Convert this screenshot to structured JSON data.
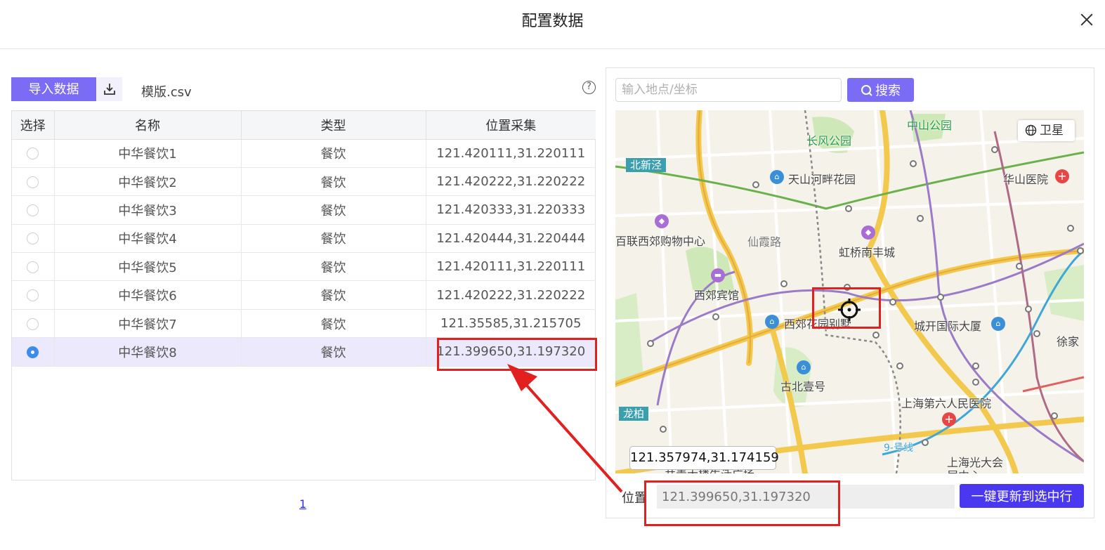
{
  "dialog": {
    "title": "配置数据"
  },
  "toolbar": {
    "import_label": "导入数据",
    "template_name": "模版.csv",
    "help_glyph": "?"
  },
  "table": {
    "headers": [
      "选择",
      "名称",
      "类型",
      "位置采集"
    ],
    "rows": [
      {
        "name": "中华餐饮1",
        "type": "餐饮",
        "position": "121.420111,31.220111",
        "selected": false
      },
      {
        "name": "中华餐饮2",
        "type": "餐饮",
        "position": "121.420222,31.220222",
        "selected": false
      },
      {
        "name": "中华餐饮3",
        "type": "餐饮",
        "position": "121.420333,31.220333",
        "selected": false
      },
      {
        "name": "中华餐饮4",
        "type": "餐饮",
        "position": "121.420444,31.220444",
        "selected": false
      },
      {
        "name": "中华餐饮5",
        "type": "餐饮",
        "position": "121.420111,31.220111",
        "selected": false
      },
      {
        "name": "中华餐饮6",
        "type": "餐饮",
        "position": "121.420222,31.220222",
        "selected": false
      },
      {
        "name": "中华餐饮7",
        "type": "餐饮",
        "position": "121.35585,31.215705",
        "selected": false
      },
      {
        "name": "中华餐饮8",
        "type": "餐饮",
        "position": "121.399650,31.197320",
        "selected": true
      }
    ]
  },
  "pagination": {
    "current": "1"
  },
  "search": {
    "placeholder": "输入地点/坐标",
    "button_label": "搜索"
  },
  "map": {
    "satellite_label": "卫星",
    "center_coord": "121.357974,31.174159",
    "labels": {
      "changfeng_park": "长风公园",
      "zhongshan_park": "中山公园",
      "beixinjing": "北新泾",
      "tianshan_garden": "天山河畔花园",
      "huashan_hospital": "华山医院",
      "bailian_mall": "百联西郊购物中心",
      "xianxia_road": "仙霞路",
      "hongqiao_nanfeng": "虹桥南丰城",
      "xijiao_hotel": "西郊宾馆",
      "xijiao_villa": "西郊花园别墅",
      "chengkai_plaza": "城开国际大厦",
      "xujia": "徐家",
      "gubei": "古北壹号",
      "longbai": "龙柏",
      "sixth_hospital": "上海第六人民医院",
      "line9": "9-号线",
      "guangda": "上海光大会",
      "guangda2": "展中心",
      "bottom_road": "共青大楼生活广场"
    },
    "colors": {
      "road_major": "#f2c94c",
      "metro_purple": "#9b7bc8",
      "metro_green": "#6ab04c",
      "metro_blue": "#3fa7d6",
      "park": "#cfe8b8"
    }
  },
  "position": {
    "label": "位置",
    "value": "121.399650,31.197320",
    "update_button": "一键更新到选中行"
  },
  "annotation": {
    "highlight_color": "#e32020"
  }
}
